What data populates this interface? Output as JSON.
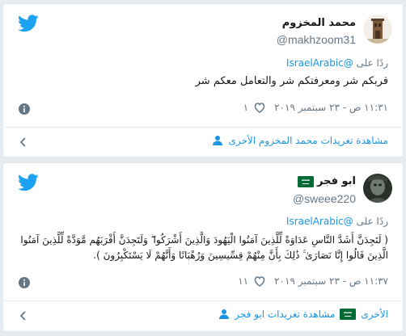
{
  "colors": {
    "twitter_blue": "#1da1f2",
    "link_blue": "#1b95e0",
    "muted_gray": "#657786",
    "saudi_green": "#006c35"
  },
  "tweets": [
    {
      "display_name": "محمد المخزوم",
      "handle": "@makhzoom31",
      "reply_prefix": "ردًا على",
      "reply_mention": "@IsraelArabic",
      "text": "قربكم شر ومعرفتكم شر والتعامل معكم شر",
      "likes": "١",
      "timestamp": "١١:٣١ ص - ٢٣ سبتمبر ٢٠١٩",
      "more_link": "مشاهدة تغريدات محمد المخزوم الأخرى",
      "icons": {
        "logo": "twitter-bird-icon",
        "like": "heart-icon",
        "info": "info-icon",
        "more": "person-icon",
        "chevron": "chevron-left-icon"
      }
    },
    {
      "display_name": "ابو فجر",
      "flag_icon": "saudi-flag-icon",
      "handle": "@sweee220",
      "reply_prefix": "ردًا على",
      "reply_mention": "@IsraelArabic",
      "text_line1": "( لَتَجِدَنَّ أَشَدَّ النَّاسِ عَدَاوَةً لِّلَّذِينَ آمَنُوا الْيَهُودَ وَالَّذِينَ أَشْرَكُوا ۖ وَلَتَجِدَنَّ أَقْرَبَهُم مَّوَدَّةً لِّلَّذِينَ آمَنُوا",
      "text_line2": "الَّذِينَ قَالُوا إِنَّا نَصَارَىٰ ۚ ذَٰلِكَ بِأَنَّ مِنْهُمْ قِسِّيسِينَ وَرُهْبَانًا وَأَنَّهُمْ لَا يَسْتَكْبِرُونَ ).",
      "likes": "١١",
      "timestamp": "١١:٣٧ ص - ٢٣ سبتمبر ٢٠١٩",
      "more_link_prefix": "مشاهدة تغريدات ابو فجر",
      "more_link_suffix": "الأخرى",
      "icons": {
        "logo": "twitter-bird-icon",
        "like": "heart-icon",
        "info": "info-icon",
        "more": "person-icon",
        "chevron": "chevron-left-icon"
      }
    }
  ]
}
